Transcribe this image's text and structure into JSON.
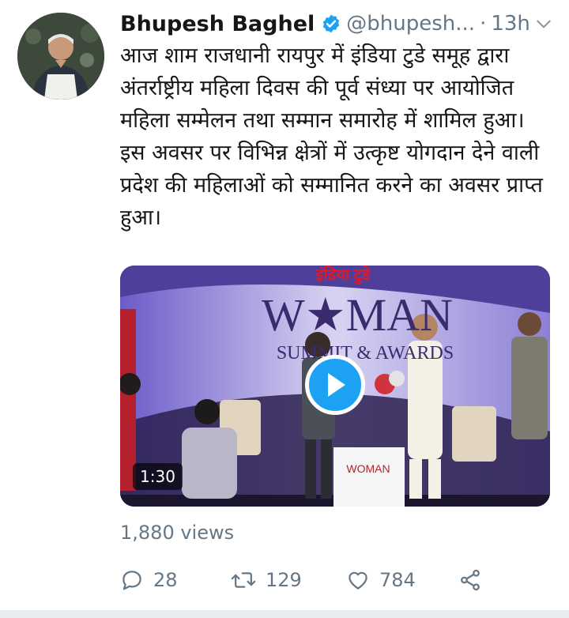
{
  "tweet": {
    "author_name": "Bhupesh Baghel",
    "handle": "@bhupesh...",
    "separator": "·",
    "time": "13h",
    "text": "आज शाम राजधानी रायपुर में इंडिया टुडे समूह द्वारा अंतर्राष्ट्रीय महिला दिवस की पूर्व संध्या पर आयोजित महिला सम्मेलन तथा सम्मान समारोह में शामिल हुआ।\nइस अवसर पर विभिन्न क्षेत्रों में उत्कृष्ट योगदान देने वाली प्रदेश की महिलाओं को सम्मानित करने का अवसर प्राप्त हुआ।",
    "media": {
      "banner_top": "इंडिया टुडे",
      "banner_title": "W★MAN",
      "banner_subtitle": "SUMMIT & AWARDS",
      "podium_text": "WOMAN",
      "duration": "1:30"
    },
    "views": "1,880 views",
    "actions": {
      "reply_count": "28",
      "retweet_count": "129",
      "like_count": "784"
    }
  },
  "colors": {
    "accent": "#1da1f2",
    "verified": "#1da1f2",
    "secondary_text": "#657786",
    "primary_text": "#14171a"
  },
  "icons": [
    "verified-badge-icon",
    "chevron-down-icon",
    "play-icon",
    "reply-icon",
    "retweet-icon",
    "like-icon",
    "share-icon"
  ]
}
